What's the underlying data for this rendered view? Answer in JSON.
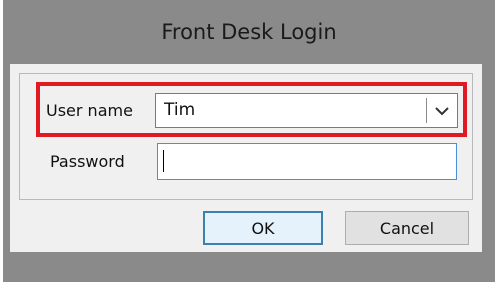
{
  "dialog": {
    "title": "Front Desk Login",
    "username": {
      "label": "User name",
      "value": "Tim"
    },
    "password": {
      "label": "Password",
      "value": ""
    },
    "buttons": {
      "ok": "OK",
      "cancel": "Cancel"
    }
  },
  "colors": {
    "frame": "#8a8a8a",
    "client": "#f0f0f0",
    "highlight": "#e01a22",
    "focus_border": "#4a90d9",
    "default_button_border": "#3c7fb1"
  }
}
